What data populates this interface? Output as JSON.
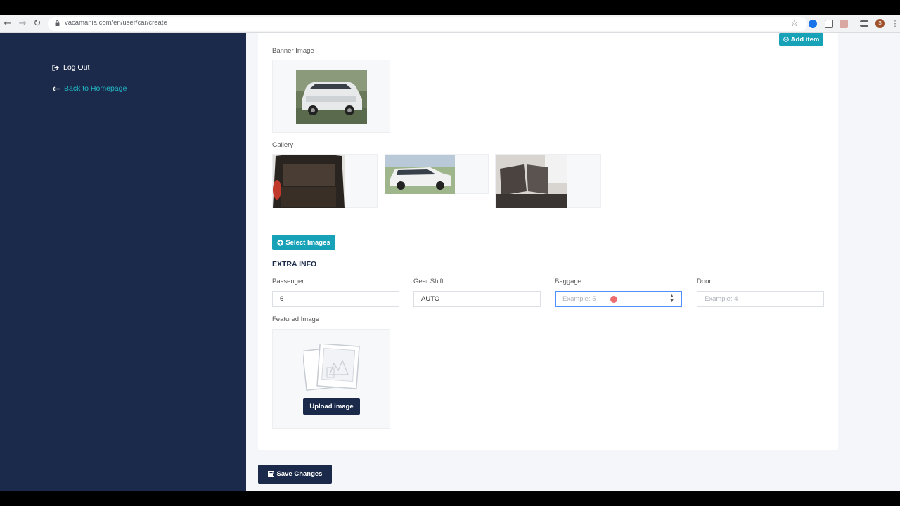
{
  "browser": {
    "url": "vacamania.com/en/user/car/create",
    "back_icon": "←",
    "forward_icon": "→",
    "reload_icon": "↻",
    "star_icon": "☆",
    "avatar_letter": "S"
  },
  "sidebar": {
    "logout_label": "Log Out",
    "back_label": "Back to Homepage"
  },
  "form": {
    "add_item_label": "Add item",
    "banner_label": "Banner Image",
    "gallery_label": "Gallery",
    "select_images_label": "Select Images",
    "extra_info_title": "EXTRA INFO",
    "fields": {
      "passenger": {
        "label": "Passenger",
        "value": "6"
      },
      "gear_shift": {
        "label": "Gear Shift",
        "value": "AUTO"
      },
      "baggage": {
        "label": "Baggage",
        "placeholder": "Example: 5"
      },
      "door": {
        "label": "Door",
        "placeholder": "Example: 4"
      }
    },
    "featured_label": "Featured Image",
    "upload_label": "Upload image"
  },
  "footer": {
    "save_label": "Save Changes"
  },
  "colors": {
    "sidebar_bg": "#1b2a4a",
    "accent_teal": "#17a2b8",
    "link_teal": "#22b8c7",
    "button_navy": "#1b2a4a"
  }
}
